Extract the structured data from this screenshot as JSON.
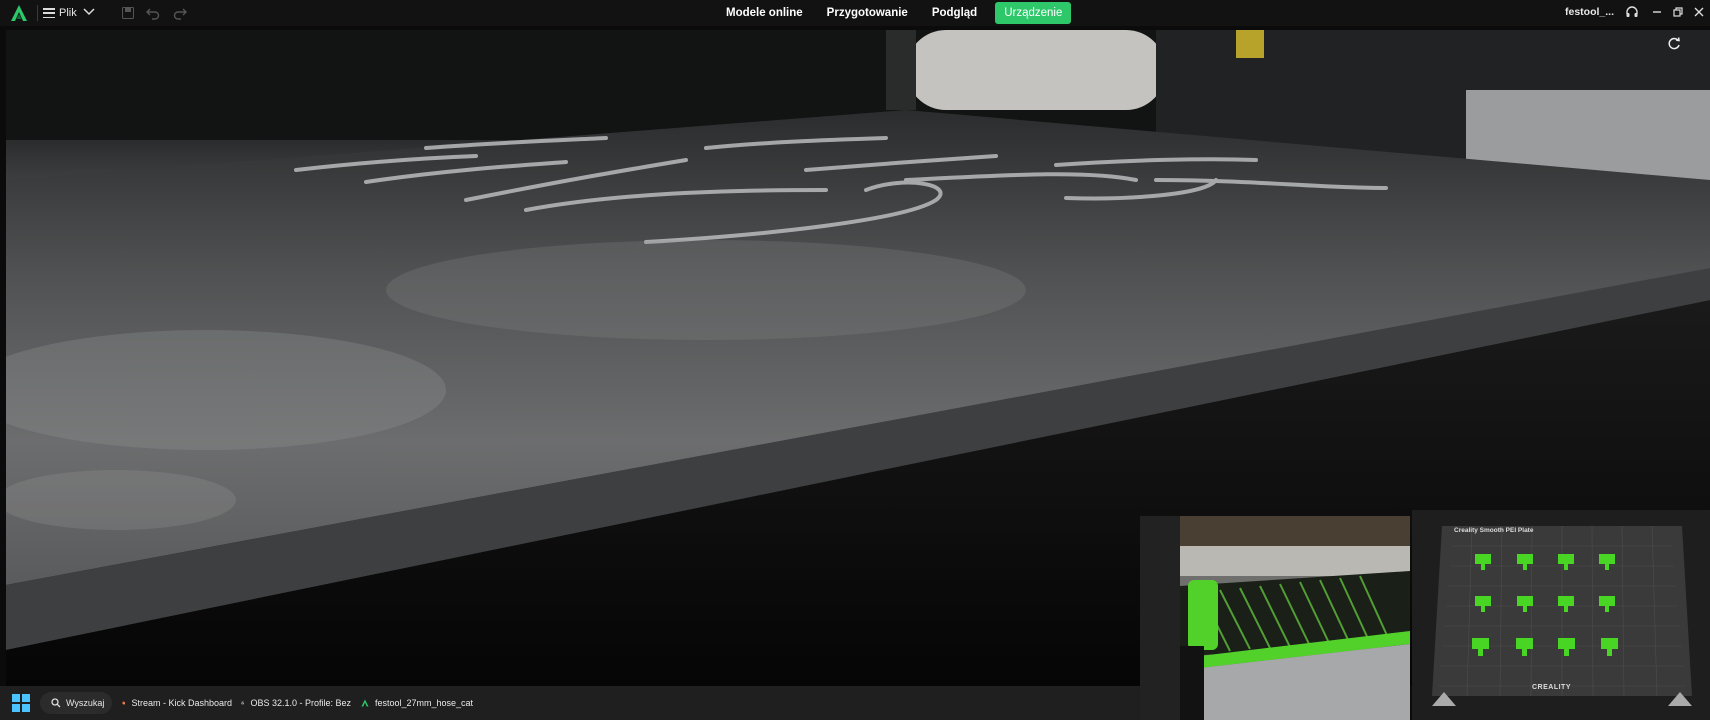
{
  "titlebar": {
    "menu_label": "Plik",
    "tabs": [
      {
        "label": "Modele online",
        "active": false
      },
      {
        "label": "Przygotowanie",
        "active": false
      },
      {
        "label": "Podgląd",
        "active": false
      },
      {
        "label": "Urządzenie",
        "active": true
      }
    ],
    "project_name": "festool_..."
  },
  "camera": {
    "refresh_icon": "refresh-icon"
  },
  "pip_plate": {
    "plate_label": "Creality Smooth PEI Plate",
    "brand": "CREALITY"
  },
  "taskbar": {
    "search_label": "Wyszukaj",
    "items": [
      {
        "label": "Stream - Kick Dashboard",
        "icon": "chrome-icon"
      },
      {
        "label": "OBS 32.1.0 - Profile: Bez",
        "icon": "obs-icon"
      },
      {
        "label": "festool_27mm_hose_cat",
        "icon": "creality-print-icon"
      }
    ]
  },
  "colors": {
    "accent": "#2ec86a",
    "titlebar_bg": "#121212",
    "taskbar_bg": "#1f1f1f"
  }
}
